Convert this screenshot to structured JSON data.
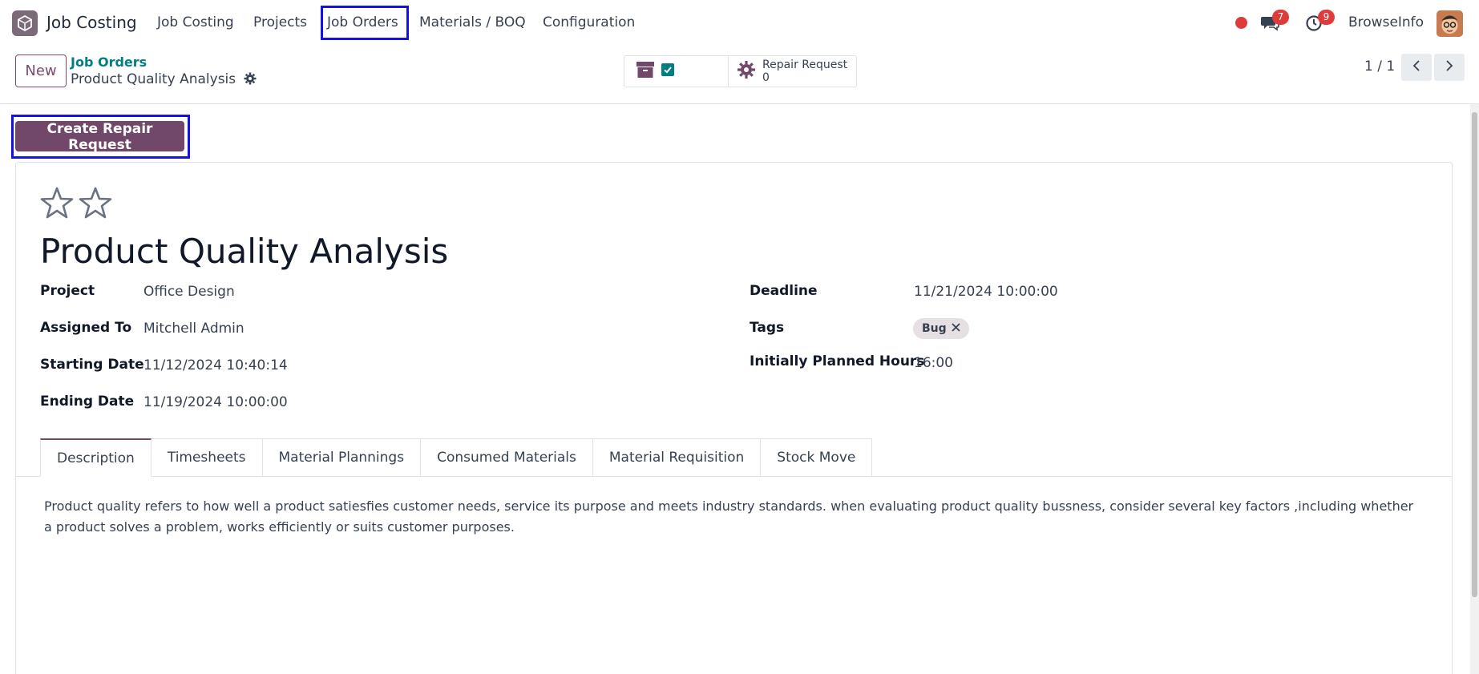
{
  "navbar": {
    "app_name": "Job Costing",
    "menu": [
      "Job Costing",
      "Projects",
      "Job Orders",
      "Materials / BOQ",
      "Configuration"
    ],
    "messages_count": "7",
    "activities_count": "9",
    "user_name": "BrowseInfo"
  },
  "control_panel": {
    "new_label": "New",
    "breadcrumb_parent": "Job Orders",
    "breadcrumb_current": "Product Quality Analysis",
    "smart_button_label": "Repair Request",
    "smart_button_count": "0",
    "pager": "1 / 1"
  },
  "action": {
    "create_repair_label": "Create Repair Request"
  },
  "form": {
    "title": "Product Quality Analysis",
    "fields_left": [
      {
        "label": "Project",
        "value": "Office Design"
      },
      {
        "label": "Assigned To",
        "value": "Mitchell Admin"
      },
      {
        "label": "Starting Date",
        "value": "11/12/2024 10:40:14"
      },
      {
        "label": "Ending Date",
        "value": "11/19/2024 10:00:00"
      }
    ],
    "fields_right": [
      {
        "label": "Deadline",
        "value": "11/21/2024 10:00:00"
      },
      {
        "label": "Tags",
        "value": "Bug"
      },
      {
        "label": "Initially Planned Hours",
        "value": "16:00"
      }
    ],
    "tabs": [
      "Description",
      "Timesheets",
      "Material Plannings",
      "Consumed Materials",
      "Material Requisition",
      "Stock Move"
    ],
    "description": "Product quality refers to how well a product satiesfies customer needs, service its purpose and meets industry standards. when evaluating product quality bussness, consider several key factors ,including whether a product solves a problem, works efficiently or suits customer purposes."
  },
  "colors": {
    "brand": "#71486a",
    "link": "#017e84",
    "badge": "#e03b3b",
    "highlight": "#1212e6"
  }
}
